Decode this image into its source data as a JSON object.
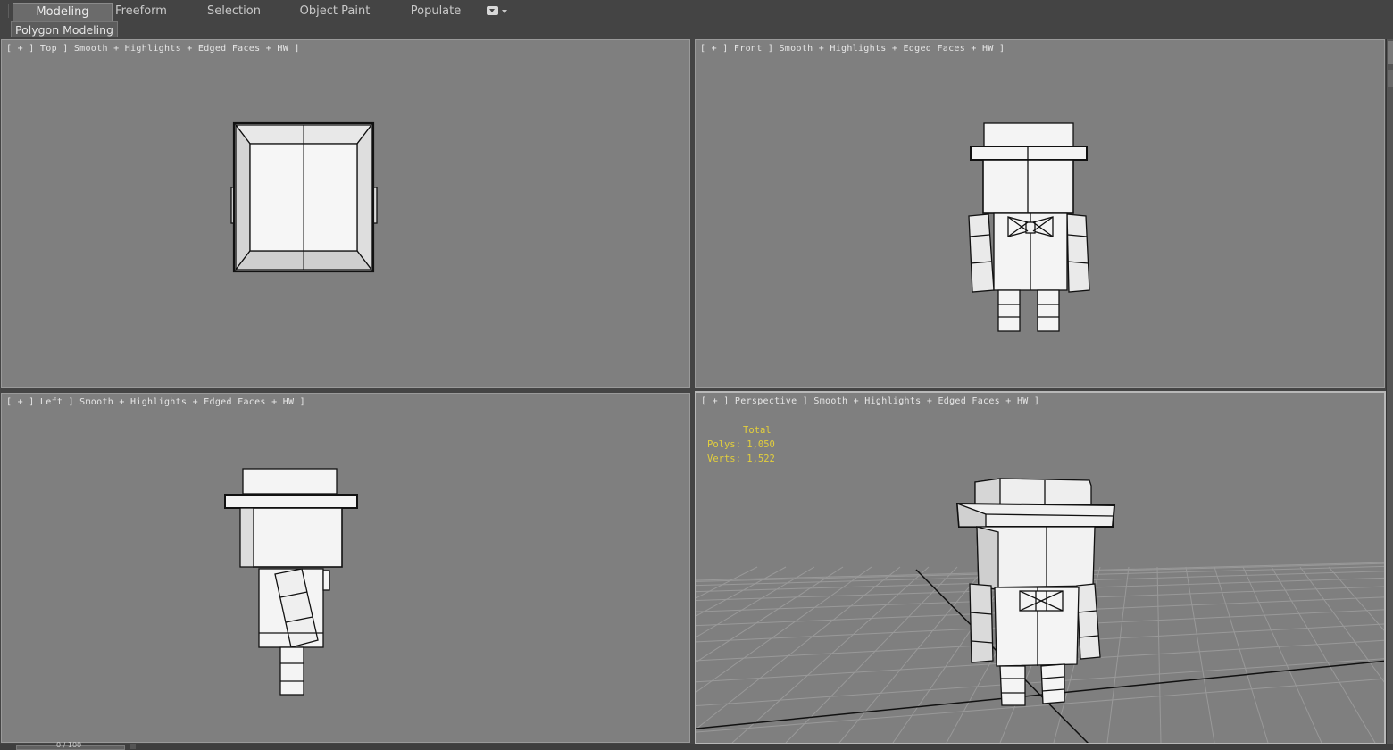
{
  "ribbon": {
    "tabs": [
      {
        "label": "Modeling",
        "active": true
      },
      {
        "label": "Freeform",
        "active": false
      },
      {
        "label": "Selection",
        "active": false
      },
      {
        "label": "Object Paint",
        "active": false
      },
      {
        "label": "Populate",
        "active": false
      }
    ],
    "dropdown_icon": "dropdown-icon"
  },
  "subribbon": {
    "panel_label": "Polygon Modeling"
  },
  "viewports": {
    "top": {
      "label": "[ + ] Top ] Smooth + Highlights + Edged Faces + HW ]"
    },
    "front": {
      "label": "[ + ] Front ] Smooth + Highlights + Edged Faces + HW ]"
    },
    "left": {
      "label": "[ + ] Left ] Smooth + Highlights + Edged Faces + HW ]"
    },
    "perspective": {
      "label": "[ + ] Perspective ] Smooth + Highlights + Edged Faces + HW ]"
    }
  },
  "stats": {
    "title": "Total",
    "polys": "Polys: 1,050",
    "verts": "Verts: 1,522"
  },
  "timeline": {
    "frame": "0 / 100"
  },
  "colors": {
    "viewport_bg": "#7f7f7f",
    "ui_bg": "#444444",
    "stats_text": "#e3cf3c",
    "model_fill": "#f4f4f4"
  }
}
